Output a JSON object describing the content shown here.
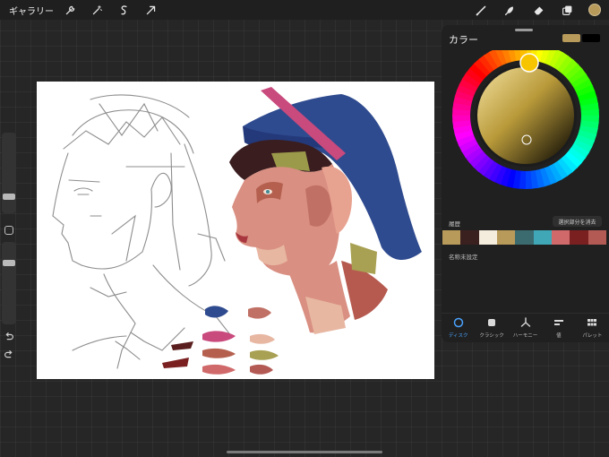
{
  "topbar": {
    "gallery_label": "ギャラリー",
    "left_icons": [
      "wrench-icon",
      "magic-wand-icon",
      "selection-icon",
      "transform-arrow-icon"
    ],
    "right_icons": [
      "brush-icon",
      "smudge-icon",
      "eraser-icon",
      "layers-icon"
    ],
    "current_color": "#b89a5a"
  },
  "panel": {
    "title": "カラー",
    "primary_color": "#b89a5a",
    "secondary_color": "#000000",
    "history_label": "履歴",
    "clear_label": "選択部分を消去",
    "history_colors": [
      "#b89a5a",
      "#3b2020",
      "#f4ecdc",
      "#b89a5a",
      "#3c6b6f",
      "#3fa7b5",
      "#d0696a",
      "#7a2020",
      "#b45a55"
    ],
    "palette_name": "名称未設定",
    "tabs": [
      {
        "label": "ディスク",
        "icon": "disc-icon"
      },
      {
        "label": "クラシック",
        "icon": "classic-icon"
      },
      {
        "label": "ハーモニー",
        "icon": "harmony-icon"
      },
      {
        "label": "値",
        "icon": "value-sliders-icon"
      },
      {
        "label": "パレット",
        "icon": "palette-grid-icon"
      }
    ],
    "active_tab": 0
  },
  "colors": {
    "background": "#262626",
    "canvas": "#ffffff",
    "accent": "#4aa3ff"
  }
}
